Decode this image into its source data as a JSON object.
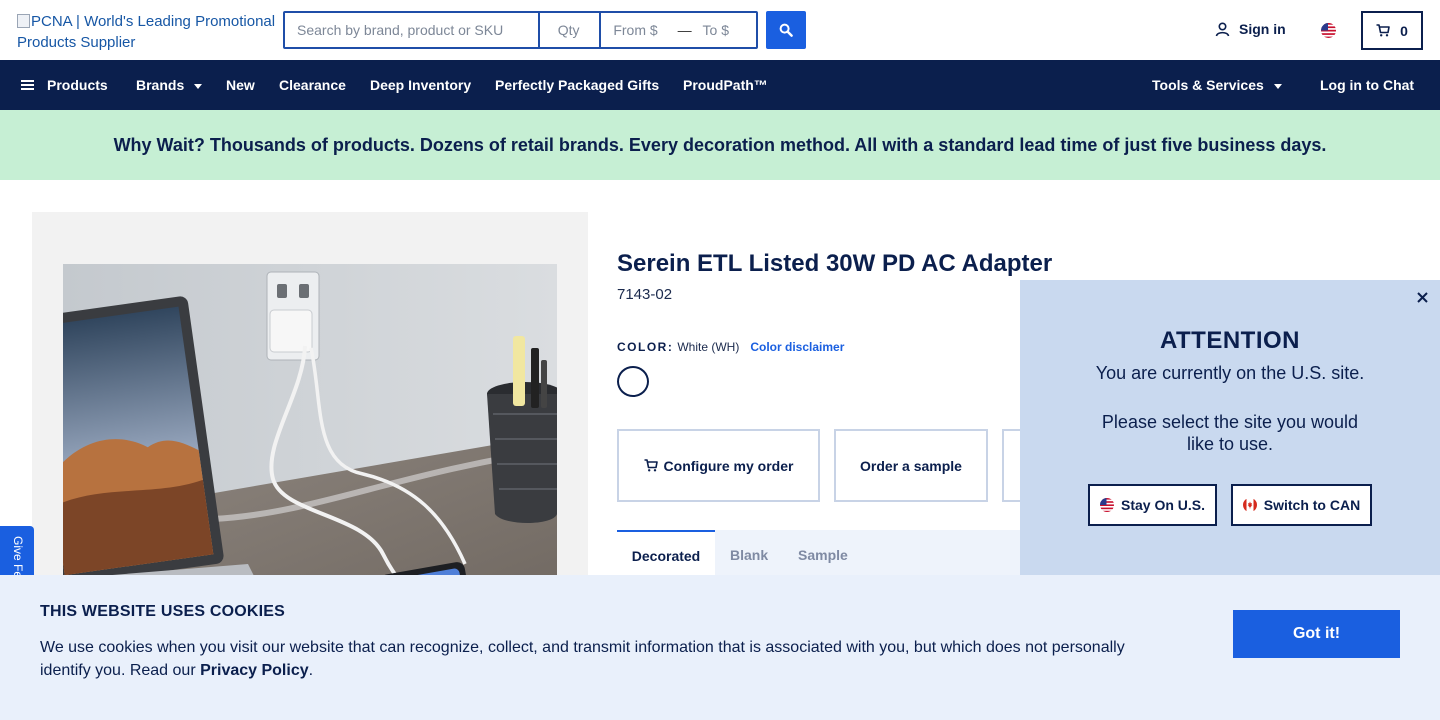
{
  "header": {
    "logo_alt": "PCNA | World's Leading Promotional Products Supplier",
    "search": {
      "query_placeholder": "Search by brand, product or SKU",
      "qty_placeholder": "Qty",
      "from_placeholder": "From $",
      "range_separator": "—",
      "to_placeholder": "To $"
    },
    "sign_in": "Sign in",
    "cart_count": "0"
  },
  "nav": {
    "products": "Products",
    "brands": "Brands",
    "new": "New",
    "clearance": "Clearance",
    "deep_inventory": "Deep Inventory",
    "packaged_gifts": "Perfectly Packaged Gifts",
    "proudpath": "ProudPath™",
    "tools": "Tools & Services",
    "chat": "Log in to Chat"
  },
  "promo": "Why Wait? Thousands of products. Dozens of retail brands. Every decoration method. All with a standard lead time of just five business days.",
  "product": {
    "name": "Serein ETL Listed 30W PD AC Adapter",
    "sku": "7143-02",
    "color_label": "COLOR:",
    "color_value": "White (WH)",
    "color_disclaimer": "Color disclaimer",
    "swatch_color": "#ffffff",
    "actions": {
      "configure": "Configure my order",
      "sample": "Order a sample"
    },
    "tabs": [
      "Decorated",
      "Blank",
      "Sample"
    ]
  },
  "feedback": "Give Feedback",
  "attention": {
    "title": "ATTENTION",
    "line1": "You are currently on the U.S. site.",
    "line2": "Please select the site you would",
    "line3": "like to use.",
    "stay_label": "Stay On U.S.",
    "switch_label": "Switch to CAN"
  },
  "cookie": {
    "title": "THIS WEBSITE USES COOKIES",
    "text": "We use cookies when you visit our website that can recognize, collect, and transmit information that is associated with you, but which does not personally identify you. Read our ",
    "link": "Privacy Policy",
    "suffix": ".",
    "button": "Got it!"
  },
  "colors": {
    "navy": "#0b1f4d",
    "accent_blue": "#1a5fe0",
    "promo_green": "#c6efd4",
    "popup_blue": "#c9d9ef",
    "cookie_bg": "#e9f0fb"
  }
}
